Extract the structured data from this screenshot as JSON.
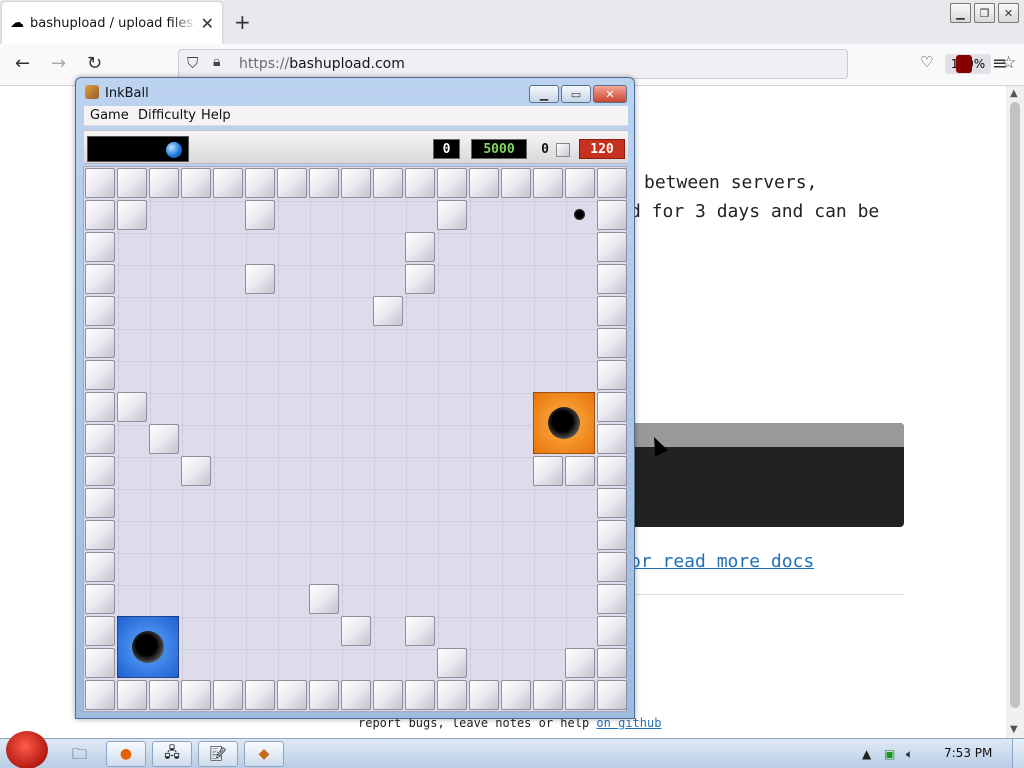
{
  "browser": {
    "tab_title": "bashupload / upload files from command line",
    "url_prefix": "https://",
    "url_domain": "bashupload.com",
    "zoom": "120%"
  },
  "page": {
    "line1": "between servers,",
    "line2": "d for 3 days and can be",
    "link_docs": "or read more docs",
    "footer_text": "report bugs, leave notes or help ",
    "footer_link": "on github"
  },
  "inkball": {
    "title": "InkBall",
    "menus": [
      "Game",
      "Difficulty",
      "Help"
    ],
    "score": "0",
    "high_score": "5000",
    "balls_lost": "0",
    "timer": "120",
    "grid_cols": 17,
    "grid_rows": 17,
    "tiles": [
      [
        1,
        1
      ],
      [
        5,
        1
      ],
      [
        11,
        1
      ],
      [
        10,
        2
      ],
      [
        5,
        3
      ],
      [
        10,
        3
      ],
      [
        9,
        4
      ],
      [
        1,
        7
      ],
      [
        2,
        8
      ],
      [
        3,
        9
      ],
      [
        14,
        9
      ],
      [
        15,
        9
      ],
      [
        7,
        13
      ],
      [
        8,
        14
      ],
      [
        10,
        14
      ],
      [
        11,
        15
      ],
      [
        15,
        15
      ]
    ],
    "holes": [
      {
        "color": "orange",
        "col": 14,
        "row": 7
      },
      {
        "color": "blue",
        "col": 1,
        "row": 14
      }
    ],
    "small_hole": {
      "col": 15,
      "row": 1
    }
  },
  "taskbar": {
    "clock": "7:53 PM"
  },
  "colors": {
    "orange_hole": "#e8730a",
    "blue_hole": "#1f5fd0",
    "timer_bg": "#c7321e",
    "high_score_text": "#7fd957"
  }
}
